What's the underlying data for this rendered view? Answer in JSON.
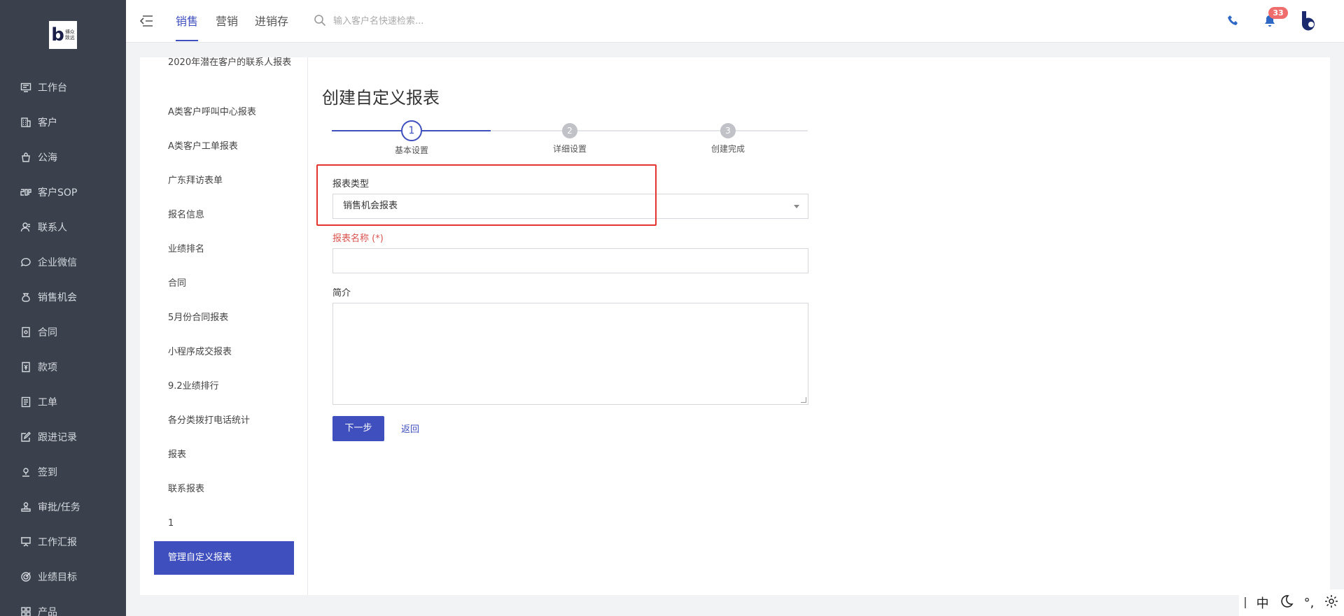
{
  "logo": {
    "letter": "b",
    "text": "博众致远"
  },
  "nav": {
    "items": [
      {
        "label": "工作台",
        "icon": "monitor-icon"
      },
      {
        "label": "客户",
        "icon": "building-icon"
      },
      {
        "label": "公海",
        "icon": "bag-icon"
      },
      {
        "label": "客户SOP",
        "icon": "sop-icon"
      },
      {
        "label": "联系人",
        "icon": "user-icon"
      },
      {
        "label": "企业微信",
        "icon": "chat-icon"
      },
      {
        "label": "销售机会",
        "icon": "money-bag-icon"
      },
      {
        "label": "合同",
        "icon": "contract-icon"
      },
      {
        "label": "款项",
        "icon": "payment-icon"
      },
      {
        "label": "工单",
        "icon": "ticket-icon"
      },
      {
        "label": "跟进记录",
        "icon": "edit-icon"
      },
      {
        "label": "签到",
        "icon": "location-icon"
      },
      {
        "label": "审批/任务",
        "icon": "stamp-icon"
      },
      {
        "label": "工作汇报",
        "icon": "presentation-icon"
      },
      {
        "label": "业绩目标",
        "icon": "target-icon"
      },
      {
        "label": "产品",
        "icon": "grid-icon"
      }
    ]
  },
  "topbar": {
    "tabs": [
      {
        "label": "销售"
      },
      {
        "label": "营销"
      },
      {
        "label": "进销存"
      }
    ],
    "search_placeholder": "输入客户名快速检索...",
    "notification_count": "33"
  },
  "sub_list": {
    "items": [
      "2020年潜在客户的联系人报表",
      "A类客户呼叫中心报表",
      "A类客户工单报表",
      "广东拜访表单",
      "报名信息",
      "业绩排名",
      "合同",
      "5月份合同报表",
      "小程序成交报表",
      "9.2业绩排行",
      "各分类拨打电话统计",
      "报表",
      "联系报表",
      "1"
    ],
    "active": "管理自定义报表"
  },
  "form": {
    "title": "创建自定义报表",
    "steps": [
      {
        "num": "1",
        "label": "基本设置"
      },
      {
        "num": "2",
        "label": "详细设置"
      },
      {
        "num": "3",
        "label": "创建完成"
      }
    ],
    "type_label": "报表类型",
    "type_value": "销售机会报表",
    "name_label": "报表名称 (*)",
    "desc_label": "简介",
    "next_label": "下一步",
    "back_label": "返回"
  },
  "ime": {
    "lang": "中",
    "punct": "°,"
  },
  "colors": {
    "nav_bg": "#3a414c",
    "accent": "#3f4fbd",
    "highlight": "#e3342f",
    "badge": "#f06d6d"
  }
}
